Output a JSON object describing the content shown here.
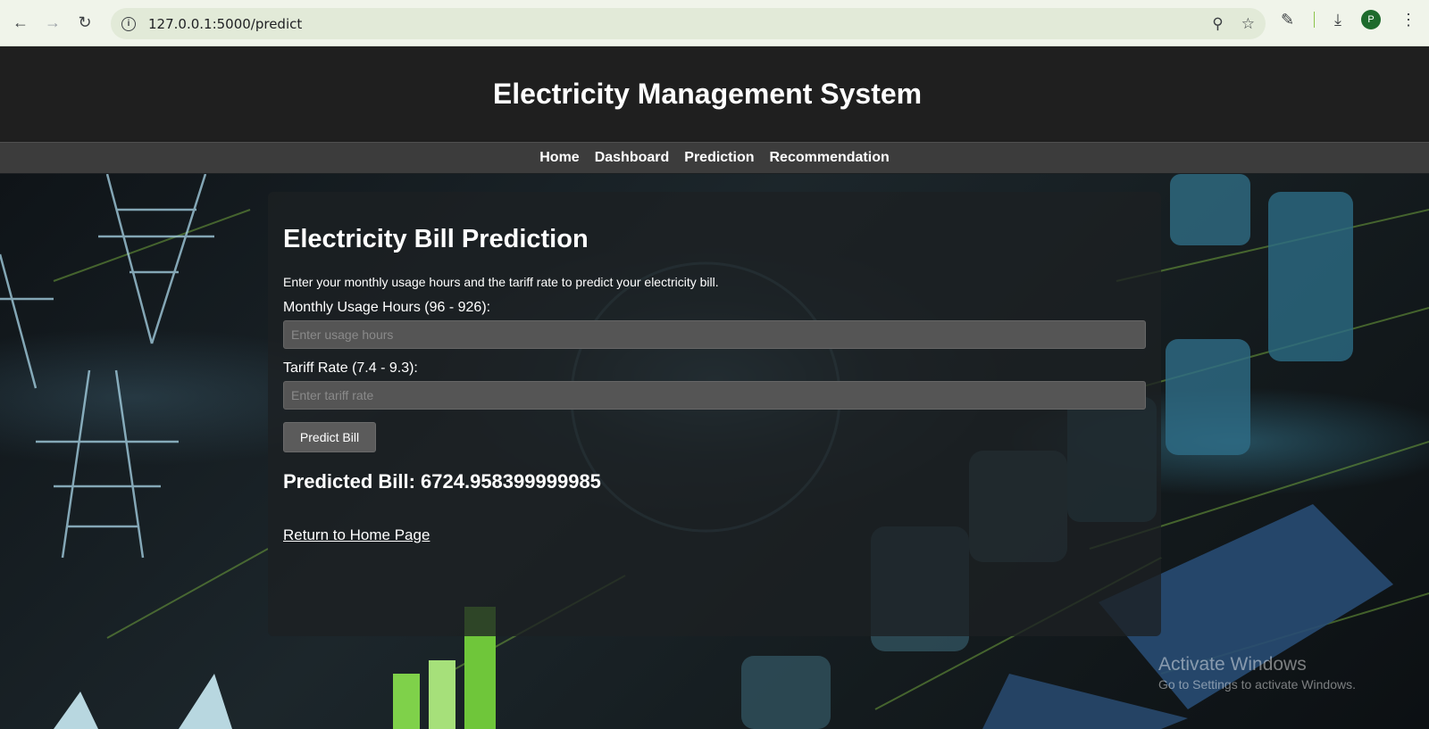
{
  "browser": {
    "url": "127.0.0.1:5000/predict",
    "profile_initial": "P"
  },
  "site": {
    "title": "Electricity Management System",
    "nav": [
      "Home",
      "Dashboard",
      "Prediction",
      "Recommendation"
    ]
  },
  "form": {
    "heading": "Electricity Bill Prediction",
    "intro": "Enter your monthly usage hours and the tariff rate to predict your electricity bill.",
    "usage_label": "Monthly Usage Hours (96 - 926):",
    "usage_placeholder": "Enter usage hours",
    "tariff_label": "Tariff Rate (7.4 - 9.3):",
    "tariff_placeholder": "Enter tariff rate",
    "submit_label": "Predict Bill",
    "result": "Predicted Bill: 6724.958399999985",
    "home_link": "Return to Home Page"
  },
  "watermark": {
    "title": "Activate Windows",
    "subtitle": "Go to Settings to activate Windows."
  },
  "icons": [
    "back-icon",
    "forward-icon",
    "reload-icon",
    "info-icon",
    "zoom-icon",
    "star-icon",
    "extensions-icon",
    "download-icon",
    "menu-icon"
  ]
}
